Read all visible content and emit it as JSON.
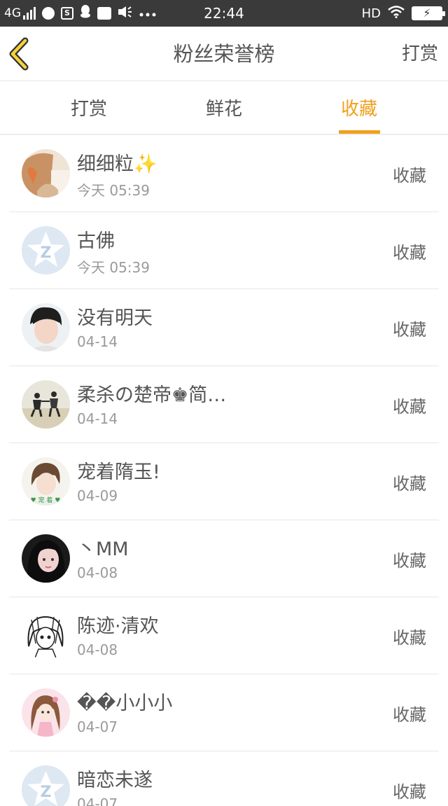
{
  "status_bar": {
    "network": "4G",
    "time": "22:44",
    "hd": "HD"
  },
  "header": {
    "title": "粉丝荣誉榜",
    "action_label": "打赏"
  },
  "tabs": [
    {
      "label": "打赏"
    },
    {
      "label": "鲜花"
    },
    {
      "label": "收藏",
      "active": true
    }
  ],
  "colors": {
    "accent": "#f0a01c",
    "status_bar": "#3a3a3a",
    "text": "#555555",
    "subtext": "#9a9a9a"
  },
  "list": [
    {
      "name": "细细粒✨",
      "time": "今天 05:39",
      "action": "收藏",
      "avatar": "photo-girl-brown"
    },
    {
      "name": "古佛",
      "time": "今天 05:39",
      "action": "收藏",
      "avatar": "default-star-avatar"
    },
    {
      "name": "没有明天",
      "time": "04-14",
      "action": "收藏",
      "avatar": "photo-boy"
    },
    {
      "name": "柔杀の楚帝♚简…",
      "time": "04-14",
      "action": "收藏",
      "avatar": "photo-beach"
    },
    {
      "name": "宠着隋玉!",
      "time": "04-09",
      "action": "收藏",
      "avatar": "photo-girl-green"
    },
    {
      "name": "丶MM",
      "time": "04-08",
      "action": "收藏",
      "avatar": "photo-girl-dark"
    },
    {
      "name": "陈迹·清欢",
      "time": "04-08",
      "action": "收藏",
      "avatar": "sketch-girl"
    },
    {
      "name": "��小小小",
      "time": "04-07",
      "action": "收藏",
      "avatar": "cartoon-girl-pink"
    },
    {
      "name": "暗恋未遂",
      "time": "04-07",
      "action": "收藏",
      "avatar": "default-star-avatar"
    }
  ]
}
